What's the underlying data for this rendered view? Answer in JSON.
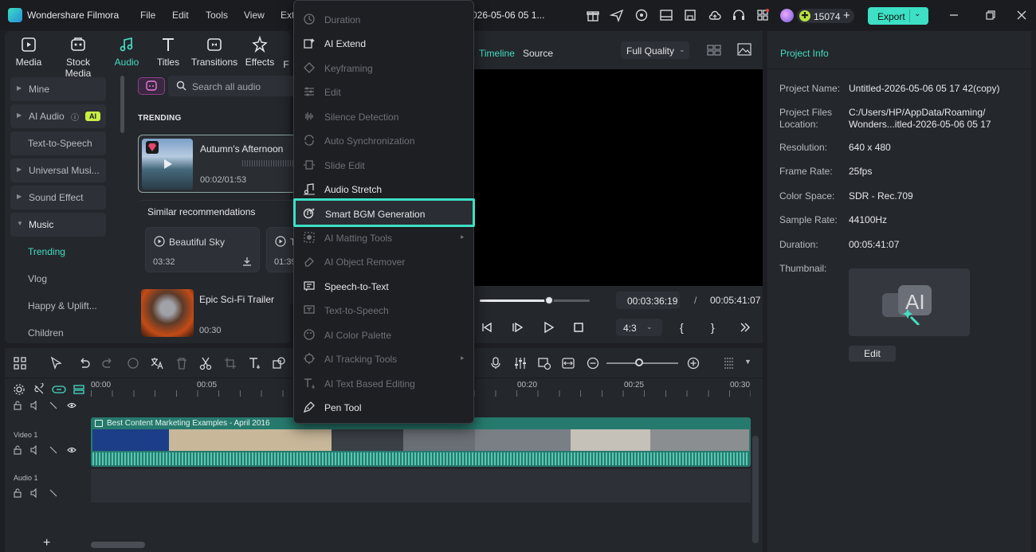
{
  "app": {
    "title": "Wondershare Filmora",
    "project_title": "026-05-06 05 1..."
  },
  "menu": [
    "File",
    "Edit",
    "Tools",
    "View",
    "Ext"
  ],
  "account": {
    "credits": "15074",
    "plus": "+"
  },
  "export": {
    "label": "Export"
  },
  "toolbar": {
    "tools": [
      {
        "label": "Media",
        "icon": "media-icon"
      },
      {
        "label": "Stock Media",
        "icon": "stock-media-icon"
      },
      {
        "label": "Audio",
        "icon": "audio-icon",
        "active": true
      },
      {
        "label": "Titles",
        "icon": "titles-icon"
      },
      {
        "label": "Transitions",
        "icon": "transitions-icon"
      },
      {
        "label": "Effects",
        "icon": "effects-icon"
      },
      {
        "label": "F",
        "icon": "filters-icon"
      }
    ]
  },
  "sidebar": {
    "items": [
      {
        "label": "Mine"
      },
      {
        "label": "AI Audio",
        "badge": "AI"
      },
      {
        "label": "Text-to-Speech"
      },
      {
        "label": "Universal Musi..."
      },
      {
        "label": "Sound Effect"
      },
      {
        "label": "Music"
      },
      {
        "label": "Trending"
      },
      {
        "label": "Vlog"
      },
      {
        "label": "Happy & Uplift..."
      },
      {
        "label": "Children"
      }
    ]
  },
  "audio_browser": {
    "search_placeholder": "Search all audio",
    "trending_label": "TRENDING",
    "featured": {
      "title": "Autumn's Afternoon",
      "time": "00:02/01:53"
    },
    "similar_label": "Similar recommendations",
    "similar": [
      {
        "title": "Beautiful Sky",
        "duration": "03:32"
      },
      {
        "title": "T",
        "duration": "01:39"
      }
    ],
    "epic": {
      "title": "Epic Sci-Fi Trailer",
      "duration": "00:30"
    }
  },
  "context_menu": {
    "items": [
      {
        "label": "Duration",
        "enabled": false,
        "icon": "clock-icon"
      },
      {
        "label": "AI Extend",
        "enabled": true,
        "icon": "ai-extend-icon"
      },
      {
        "label": "Keyframing",
        "enabled": false,
        "icon": "keyframe-icon"
      },
      {
        "label": "Edit",
        "enabled": false,
        "icon": "sliders-icon"
      },
      {
        "label": "Silence Detection",
        "enabled": false,
        "icon": "waveform-icon"
      },
      {
        "label": "Auto Synchronization",
        "enabled": false,
        "icon": "sync-icon"
      },
      {
        "label": "Slide Edit",
        "enabled": false,
        "icon": "slide-icon"
      },
      {
        "label": "Audio Stretch",
        "enabled": true,
        "icon": "audio-stretch-icon"
      },
      {
        "label": "Smart BGM Generation",
        "enabled": true,
        "highlighted": true,
        "icon": "smart-bgm-icon"
      },
      {
        "label": "AI Matting Tools",
        "enabled": false,
        "submenu": true,
        "icon": "matting-icon"
      },
      {
        "label": "AI Object Remover",
        "enabled": false,
        "icon": "eraser-icon"
      },
      {
        "label": "Speech-to-Text",
        "enabled": true,
        "icon": "speech-icon"
      },
      {
        "label": "Text-to-Speech",
        "enabled": false,
        "icon": "tts-icon"
      },
      {
        "label": "AI Color Palette",
        "enabled": false,
        "icon": "palette-icon"
      },
      {
        "label": "AI Tracking Tools",
        "enabled": false,
        "submenu": true,
        "icon": "tracking-icon"
      },
      {
        "label": "AI Text Based Editing",
        "enabled": false,
        "icon": "text-edit-icon"
      },
      {
        "label": "Pen Tool",
        "enabled": true,
        "icon": "pen-icon"
      }
    ]
  },
  "player": {
    "tabs": [
      "Timeline",
      "Source"
    ],
    "quality": "Full Quality",
    "current_time": "00:03:36:19",
    "separator": "/",
    "total_time": "00:05:41:07",
    "progress": 0.63,
    "aspect_ratio": "4:3",
    "mark_in": "{",
    "mark_out": "}"
  },
  "project_info": {
    "title": "Project Info",
    "rows": [
      {
        "key": "Project Name:",
        "value": "Untitled-2026-05-06 05 17 42(copy)"
      },
      {
        "key": "Project Files Location:",
        "value": "C:/Users/HP/AppData/Roaming/ Wonders...itled-2026-05-06 05 17"
      },
      {
        "key": "Resolution:",
        "value": "640 x 480"
      },
      {
        "key": "Frame Rate:",
        "value": "25fps"
      },
      {
        "key": "Color Space:",
        "value": "SDR - Rec.709"
      },
      {
        "key": "Sample Rate:",
        "value": "44100Hz"
      },
      {
        "key": "Duration:",
        "value": "00:05:41:07"
      },
      {
        "key": "Thumbnail:",
        "value": ""
      }
    ],
    "thumb_edit": "Edit"
  },
  "timeline": {
    "ruler": [
      "00:00",
      "00:05",
      "00:20",
      "00:25",
      "00:30"
    ],
    "video_track": {
      "label": "Video 1",
      "clip_title": "Best Content Marketing Examples - April 2016"
    },
    "audio_track": {
      "label": "Audio 1"
    },
    "add": "+",
    "zoom": 0.45
  },
  "colors": {
    "accent": "#3de0c4",
    "bg": "#1d1f24",
    "panel": "#24272c"
  }
}
